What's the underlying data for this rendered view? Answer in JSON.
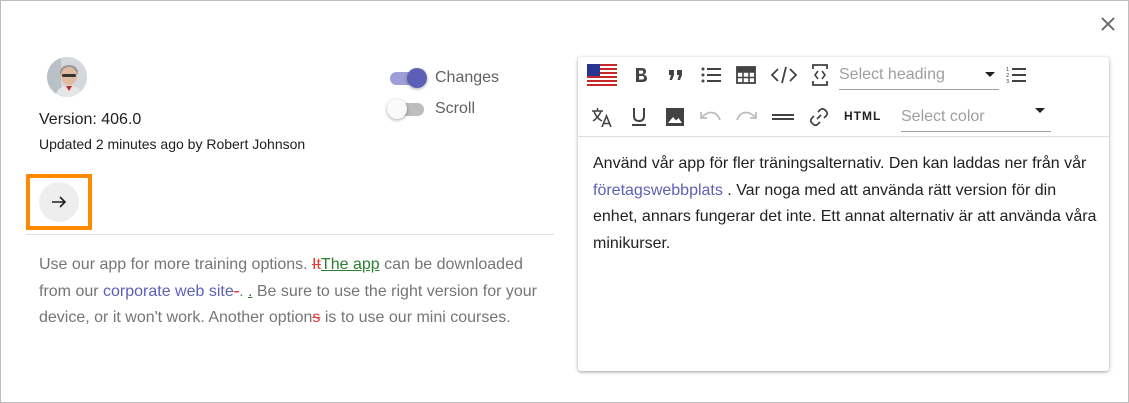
{
  "avatar": {
    "alt": "Robert Johnson avatar"
  },
  "version_text": "Version: 406.0",
  "updated_text": "Updated 2 minutes ago by Robert Johnson",
  "toggles": {
    "changes": {
      "label": "Changes",
      "on": true
    },
    "scroll": {
      "label": "Scroll",
      "on": false
    }
  },
  "diff": {
    "seg1": "Use our app for more training options. ",
    "del1": "It",
    "ins1": "The app",
    "seg2": " can be downloaded from our ",
    "link": "corporate web site",
    "del2": "-",
    "seg3": ". ",
    "ins2": ".",
    "seg4": " Be sure to use the right version for your device, or it won't work. Another option",
    "del3": "s",
    "seg5": " is to use our mini courses."
  },
  "editor": {
    "toolbar": {
      "heading_placeholder": "Select heading",
      "color_placeholder": "Select color",
      "html_label": "HTML",
      "icons": [
        "us-flag-icon",
        "bold-icon",
        "quote-icon",
        "bulleted-list-icon",
        "table-icon",
        "code-icon",
        "source-icon",
        "numbered-list-icon",
        "translate-icon",
        "underline-icon",
        "image-icon",
        "undo-icon",
        "redo-icon",
        "horizontal-rule-icon",
        "link-icon"
      ]
    },
    "content": {
      "seg1": "Använd vår app för fler träningsalternativ. Den kan laddas ner från vår ",
      "link": "företagswebbplats",
      "seg2": " . Var noga med att använda rätt version för din enhet, annars fungerar det inte. Ett annat alternativ är att använda våra minikurser."
    }
  },
  "colors": {
    "accent": "#5c5fb5",
    "highlight": "#ff8a00",
    "deleted": "#e53935",
    "inserted": "#2e7d32"
  }
}
